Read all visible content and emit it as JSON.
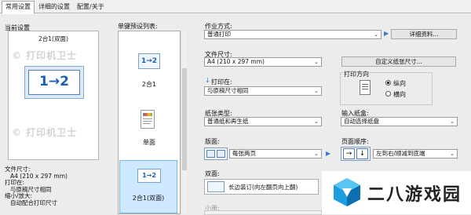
{
  "tabs": [
    {
      "label": "常用设置"
    },
    {
      "label": "详细的设置"
    },
    {
      "label": "配置/关于"
    }
  ],
  "left": {
    "current_label": "当前设置",
    "preview_caption": "2合1(双面)",
    "preview_glyph": "1→2",
    "watermark": "© 打印机卫士",
    "summary": {
      "paper_size_label": "文件尺寸:",
      "paper_size_value": "A4 (210 x 297 mm)",
      "print_on_label": "打印在:",
      "print_on_value": "与原稿尺寸相同",
      "zoom_label": "缩小/放大:",
      "zoom_value": "自动配合打印尺寸"
    }
  },
  "preset": {
    "label": "单键预设列表:",
    "items": [
      {
        "glyph": "1→2",
        "label": "2合1"
      },
      {
        "glyph": "",
        "label": "单面"
      },
      {
        "glyph": "1→2",
        "label": "2合1(双面)"
      }
    ]
  },
  "form": {
    "job_mode_label": "作业方式:",
    "job_mode_value": "普通打印",
    "details_button": "详细资料...",
    "doc_size_label": "文件尺寸:",
    "doc_size_value": "A4 (210 x 297 mm)",
    "custom_size_button": "自定义纸张尺寸...",
    "print_on_label": "打印在:",
    "print_on_value": "与原稿尺寸相同",
    "orientation_label": "打印方向",
    "portrait_label": "纵向",
    "landscape_label": "横向",
    "paper_type_label": "纸张类型:",
    "paper_type_value": "普通纸和再生纸",
    "input_tray_label": "输入纸盒:",
    "input_tray_value": "自动选择纸盘",
    "layout_label": "版面:",
    "layout_value": "每张两页",
    "page_order_label": "页面顺序:",
    "page_order_value": "左到右/顺减到底端",
    "duplex_label": "双面:",
    "duplex_value": "长边装订(向左翻页向上翻)",
    "booklet_label": "小册:"
  },
  "brand_watermark": "二八游戏园"
}
